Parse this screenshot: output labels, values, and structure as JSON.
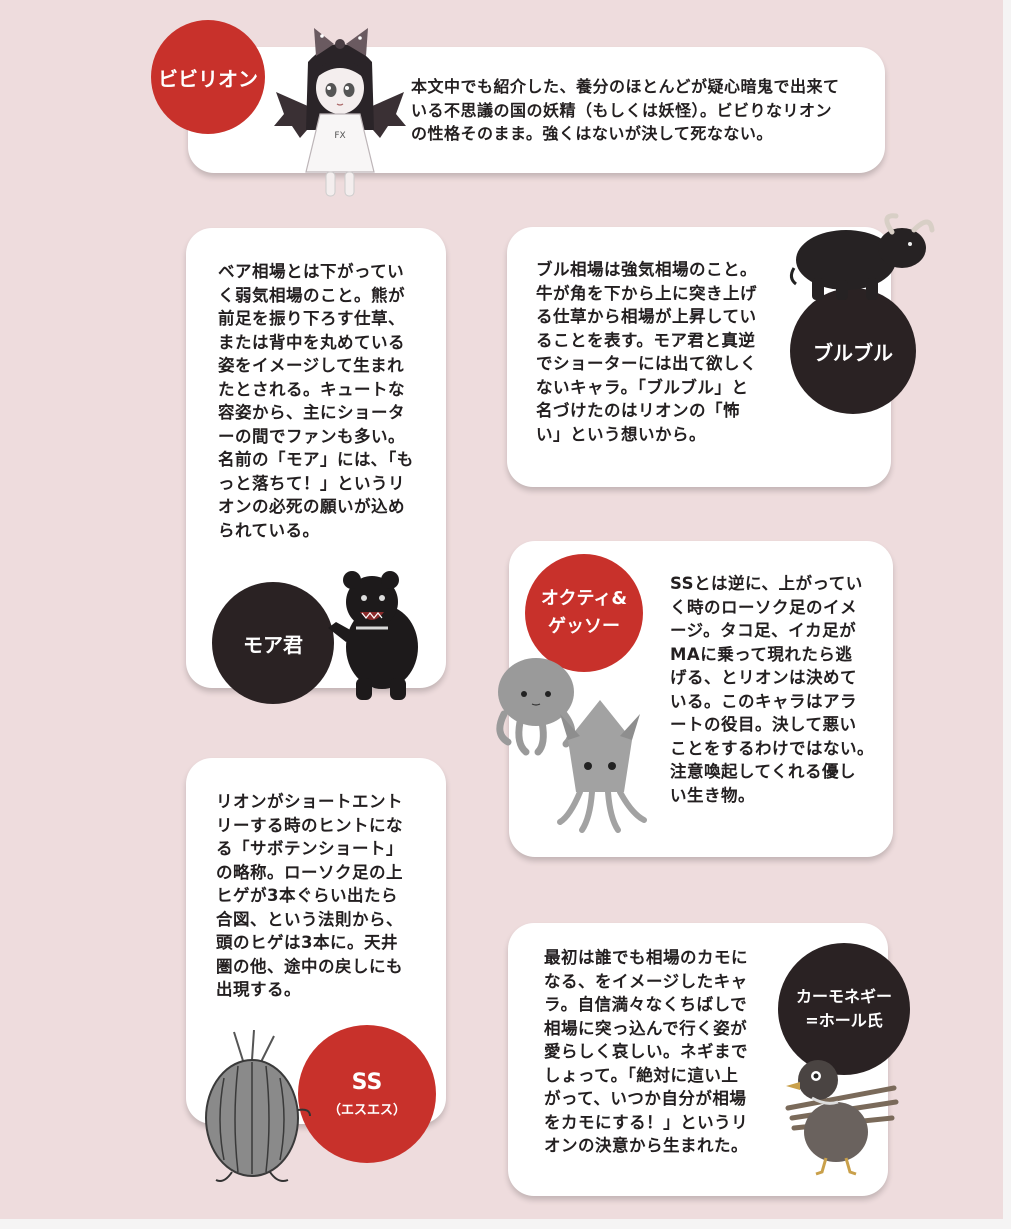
{
  "characters": {
    "bibirion": {
      "name": "ビビリオン",
      "description": "本文中でも紹介した、養分のほとんどが疑心暗鬼で出来て\nいる不思議の国の妖精（もしくは妖怪）。ビビりなリオン\nの性格そのまま。強くはないが決して死なない。",
      "color": "#c8312b"
    },
    "moa": {
      "name": "モア君",
      "description": "ベア相場とは下がってい\nく弱気相場のこと。熊が\n前足を振り下ろす仕草、\nまたは背中を丸めている\n姿をイメージして生まれ\nたとされる。キュートな\n容姿から、主にショータ\nーの間でファンも多い。\n名前の「モア」には､「も\nっと落ちて！」というリ\nオンの必死の願いが込め\nられている。",
      "color": "#2a2223"
    },
    "burubulu": {
      "name": "ブルブル",
      "description": "ブル相場は強気相場のこと。\n牛が角を下から上に突き上げ\nる仕草から相場が上昇してい\nることを表す。モア君と真逆\nでショーターには出て欲しく\nないキャラ。「ブルブル」と\n名づけたのはリオンの「怖\nい」という想いから。",
      "color": "#2a2223"
    },
    "octy": {
      "name": "オクティ&\nゲッソー",
      "description": "SSとは逆に、上がってい\nく時のローソク足のイメ\nージ。タコ足、イカ足が\nMAに乗って現れたら逃\nげる、とリオンは決めて\nいる。このキャラはアラ\nートの役目。決して悪い\nことをするわけではない。\n注意喚起してくれる優し\nい生き物。",
      "color": "#c8312b"
    },
    "ss": {
      "name": "SS",
      "reading": "（エスエス）",
      "description": "リオンがショートエント\nリーする時のヒントにな\nる「サボテンショート」\nの略称。ローソク足の上\nヒゲが3本ぐらい出たら\n合図、という法則から、\n頭のヒゲは3本に。天井\n圏の他、途中の戻しにも\n出現する。",
      "color": "#c8312b"
    },
    "kamo": {
      "name": "カーモネギー\n=ホール氏",
      "description": "最初は誰でも相場のカモに\nなる、をイメージしたキャ\nラ。自信満々なくちばしで\n相場に突っ込んで行く姿が\n愛らしく哀しい。ネギまで\nしょって。「絶対に這い上\nがって、いつか自分が相場\nをカモにする！」というリ\nオンの決意から生まれた。",
      "color": "#2a2223"
    }
  },
  "illustrations": {
    "fairy": "bat-winged-girl-illustration",
    "bear": "black-bear-illustration",
    "bull": "black-bull-illustration",
    "octopus": "octopus-illustration",
    "squid": "squid-illustration",
    "cactus": "cactus-illustration",
    "duck": "duck-with-leeks-illustration"
  }
}
